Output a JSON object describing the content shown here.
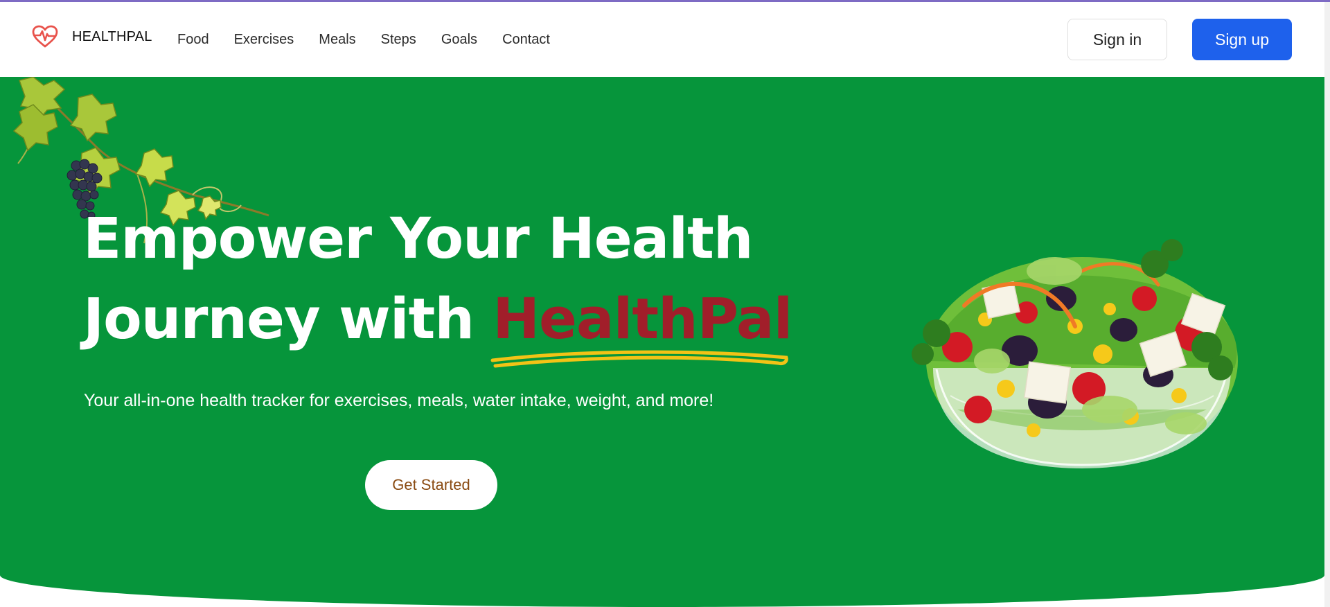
{
  "navbar": {
    "brand": {
      "name": "HEALTHPAL",
      "icon": "heart-pulse-icon"
    },
    "links": [
      {
        "label": "Food"
      },
      {
        "label": "Exercises"
      },
      {
        "label": "Meals"
      },
      {
        "label": "Steps"
      },
      {
        "label": "Goals"
      },
      {
        "label": "Contact"
      }
    ],
    "signin_label": "Sign in",
    "signup_label": "Sign up"
  },
  "hero": {
    "headline_line1": "Empower Your Health",
    "headline_line2_prefix": "Journey with ",
    "headline_highlight": "HealthPal",
    "tagline": "Your all-in-one health tracker for exercises, meals, water intake, weight, and more!",
    "cta_label": "Get Started",
    "decor_image": "grapevine-illustration",
    "main_image": "salad-bowl-illustration"
  },
  "colors": {
    "accent": "#1e61ec",
    "hero_bg": "#06953b",
    "highlight": "#a11e2a",
    "underline": "#f2c316",
    "cta_text": "#8a4b12"
  }
}
